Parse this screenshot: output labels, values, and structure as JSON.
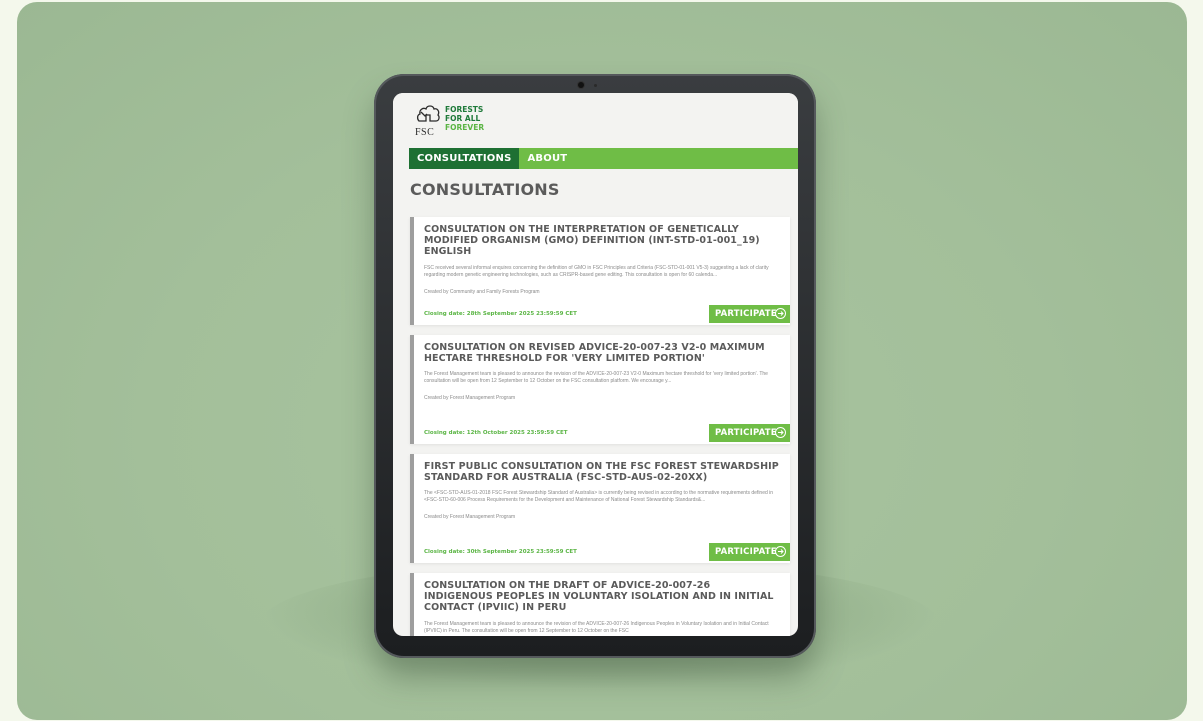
{
  "logo": {
    "tagline_line1": "FORESTS",
    "tagline_line2": "FOR ALL",
    "tagline_line3": "FOREVER",
    "brand": "FSC",
    "icon": "fsc-tree-logo"
  },
  "nav": {
    "tabs": [
      {
        "label": "CONSULTATIONS",
        "active": true
      },
      {
        "label": "ABOUT",
        "active": false
      }
    ]
  },
  "page": {
    "title": "CONSULTATIONS"
  },
  "consultations": [
    {
      "title": "CONSULTATION ON THE INTERPRETATION OF GENETICALLY MODIFIED ORGANISM (GMO) DEFINITION (INT-STD-01-001_19) ENGLISH",
      "description": "FSC received several informal enquires concerning the definition of GMO in FSC Principles and Criteria (FSC-STD-01-001 V5-3) suggesting a lack of clarity regarding modern genetic engineering technologies, such as CRISPR-based gene editing. This consultation is open for 60 calenda...",
      "creator": "Created by Community and Family Forests Program",
      "closing": "Closing date: 28th September 2025 23:59:59 CET",
      "action": "PARTICIPATE"
    },
    {
      "title": "CONSULTATION ON REVISED ADVICE-20-007-23 V2-0 MAXIMUM HECTARE THRESHOLD FOR 'VERY LIMITED PORTION'",
      "description": "The Forest Management team is pleased to announce the revision of the ADVICE-20-007-23 V2-0 Maximum hectare threshold for 'very limited portion'. The consultation will be open from 12 September to 12 October on the FSC consultation platform. We encourage y...",
      "creator": "Created by Forest Management Program",
      "closing": "Closing date: 12th October 2025 23:59:59 CET",
      "action": "PARTICIPATE"
    },
    {
      "title": "FIRST PUBLIC CONSULTATION ON THE FSC FOREST STEWARDSHIP STANDARD FOR AUSTRALIA (FSC-STD-AUS-02-20XX)",
      "description": "The <FSC-STD-AUS-01-2018 FSC Forest Stewardship Standard of Australia> is currently being revised in according to the normative requirements defined in <FSC-STD-60-006 Process Requirements for the Development and Maintenance of National Forest Stewardship Standards&...",
      "creator": "Created by Forest Management Program",
      "closing": "Closing date: 30th September 2025 23:59:59 CET",
      "action": "PARTICIPATE"
    },
    {
      "title": "CONSULTATION ON THE DRAFT OF ADVICE-20-007-26 INDIGENOUS PEOPLES IN VOLUNTARY ISOLATION AND IN INITIAL CONTACT (IPVIIC) IN PERU",
      "description": "The Forest Management team is pleased to announce the revision of the ADVICE-20-007-26 Indigenous Peoples in Voluntary Isolation and in Initial Contact (IPVIIC) in Peru. The consultation will be open from 12 September to 12 October on the FSC",
      "creator": "",
      "closing": "",
      "action": ""
    }
  ],
  "colors": {
    "brand_green": "#6fbd46",
    "dark_green": "#1e7033",
    "backdrop": "#a3bf9a"
  }
}
